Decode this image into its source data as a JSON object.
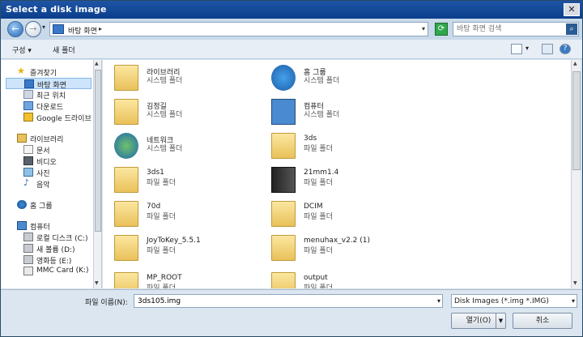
{
  "window": {
    "title": "Select a disk image",
    "close_glyph": "✕"
  },
  "address": {
    "location": "바탕 화면",
    "search_placeholder": "바탕 화면 검색"
  },
  "toolbar": {
    "organize": "구성 ▾",
    "new_folder": "새 폴더",
    "help": "?"
  },
  "sidebar": {
    "items": [
      {
        "label": "즐겨찾기",
        "icon": "star-icon"
      },
      {
        "label": "바탕 화면",
        "icon": "desktop-icon"
      },
      {
        "label": "최근 위치",
        "icon": "recent-icon"
      },
      {
        "label": "다운로드",
        "icon": "download-icon"
      },
      {
        "label": "Google 드라이브",
        "icon": "drive-icon"
      },
      {
        "label": "라이브러리",
        "icon": "library-icon"
      },
      {
        "label": "문서",
        "icon": "document-icon"
      },
      {
        "label": "비디오",
        "icon": "video-icon"
      },
      {
        "label": "사진",
        "icon": "picture-icon"
      },
      {
        "label": "음악",
        "icon": "music-icon"
      },
      {
        "label": "홈 그룹",
        "icon": "homegroup-icon"
      },
      {
        "label": "컴퓨터",
        "icon": "computer-icon"
      },
      {
        "label": "로컬 디스크 (C:)",
        "icon": "disk-icon"
      },
      {
        "label": "새 볼륨 (D:)",
        "icon": "disk-icon"
      },
      {
        "label": "영화등 (E:)",
        "icon": "disk-icon"
      },
      {
        "label": "MMC Card (K:)",
        "icon": "card-icon"
      }
    ]
  },
  "files": [
    {
      "name": "라이브러리",
      "type": "시스템 폴더"
    },
    {
      "name": "홈 그룹",
      "type": "시스템 폴더"
    },
    {
      "name": "김정길",
      "type": "시스템 폴더"
    },
    {
      "name": "컴퓨터",
      "type": "시스템 폴더"
    },
    {
      "name": "네트워크",
      "type": "시스템 폴더"
    },
    {
      "name": "3ds",
      "type": "파일 폴더"
    },
    {
      "name": "3ds1",
      "type": "파일 폴더"
    },
    {
      "name": "21mm1.4",
      "type": "파일 폴더"
    },
    {
      "name": "70d",
      "type": "파일 폴더"
    },
    {
      "name": "DCIM",
      "type": "파일 폴더"
    },
    {
      "name": "JoyToKey_5.5.1",
      "type": "파일 폴더"
    },
    {
      "name": "menuhax_v2.2 (1)",
      "type": "파일 폴더"
    },
    {
      "name": "MP_ROOT",
      "type": "파일 폴더"
    },
    {
      "name": "output",
      "type": "파일 폴더"
    }
  ],
  "bottom": {
    "filename_label": "파일 이름(N):",
    "filename_value": "3ds105.img",
    "filter_value": "Disk Images (*.img *.IMG)",
    "open_label": "열기(O)",
    "cancel_label": "취소"
  },
  "colors": {
    "accent": "#0b3e8c",
    "selection": "#cde4fa"
  }
}
